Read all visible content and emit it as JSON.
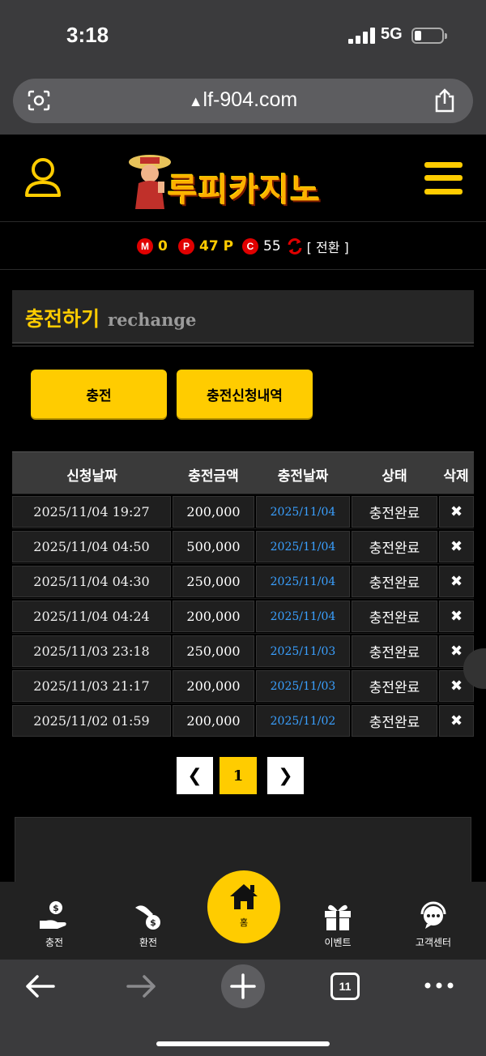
{
  "status_bar": {
    "time": "3:18",
    "network": "5G"
  },
  "browser": {
    "url": "lf-904.com",
    "tab_count": "11"
  },
  "site": {
    "logo_text": "루피카지노"
  },
  "points": {
    "m_badge": "M",
    "m_value": "0",
    "p_badge": "P",
    "p_value": "47 P",
    "c_badge": "C",
    "c_value": "55",
    "convert_label": "[ 전환 ]"
  },
  "page": {
    "title": "충전하기",
    "subtitle": "rechange"
  },
  "buttons": {
    "charge": "충전",
    "history": "충전신청내역"
  },
  "table": {
    "headers": [
      "신청날짜",
      "충전금액",
      "충전날짜",
      "상태",
      "삭제"
    ],
    "rows": [
      {
        "request_date": "2025/11/04 19:27",
        "amount": "200,000",
        "charge_date": "2025/11/04",
        "status": "충전완료",
        "delete": "✖"
      },
      {
        "request_date": "2025/11/04 04:50",
        "amount": "500,000",
        "charge_date": "2025/11/04",
        "status": "충전완료",
        "delete": "✖"
      },
      {
        "request_date": "2025/11/04 04:30",
        "amount": "250,000",
        "charge_date": "2025/11/04",
        "status": "충전완료",
        "delete": "✖"
      },
      {
        "request_date": "2025/11/04 04:24",
        "amount": "200,000",
        "charge_date": "2025/11/04",
        "status": "충전완료",
        "delete": "✖"
      },
      {
        "request_date": "2025/11/03 23:18",
        "amount": "250,000",
        "charge_date": "2025/11/03",
        "status": "충전완료",
        "delete": "✖"
      },
      {
        "request_date": "2025/11/03 21:17",
        "amount": "200,000",
        "charge_date": "2025/11/03",
        "status": "충전완료",
        "delete": "✖"
      },
      {
        "request_date": "2025/11/02 01:59",
        "amount": "200,000",
        "charge_date": "2025/11/02",
        "status": "충전완료",
        "delete": "✖"
      }
    ]
  },
  "pagination": {
    "prev": "❮",
    "current": "1",
    "next": "❯"
  },
  "bottom_nav": {
    "charge": "충전",
    "withdraw": "환전",
    "home": "홈",
    "event": "이벤트",
    "support": "고객센터"
  },
  "colors": {
    "accent": "#ffcc00",
    "badge_red": "#e00000",
    "link_blue": "#3aa0ff"
  }
}
